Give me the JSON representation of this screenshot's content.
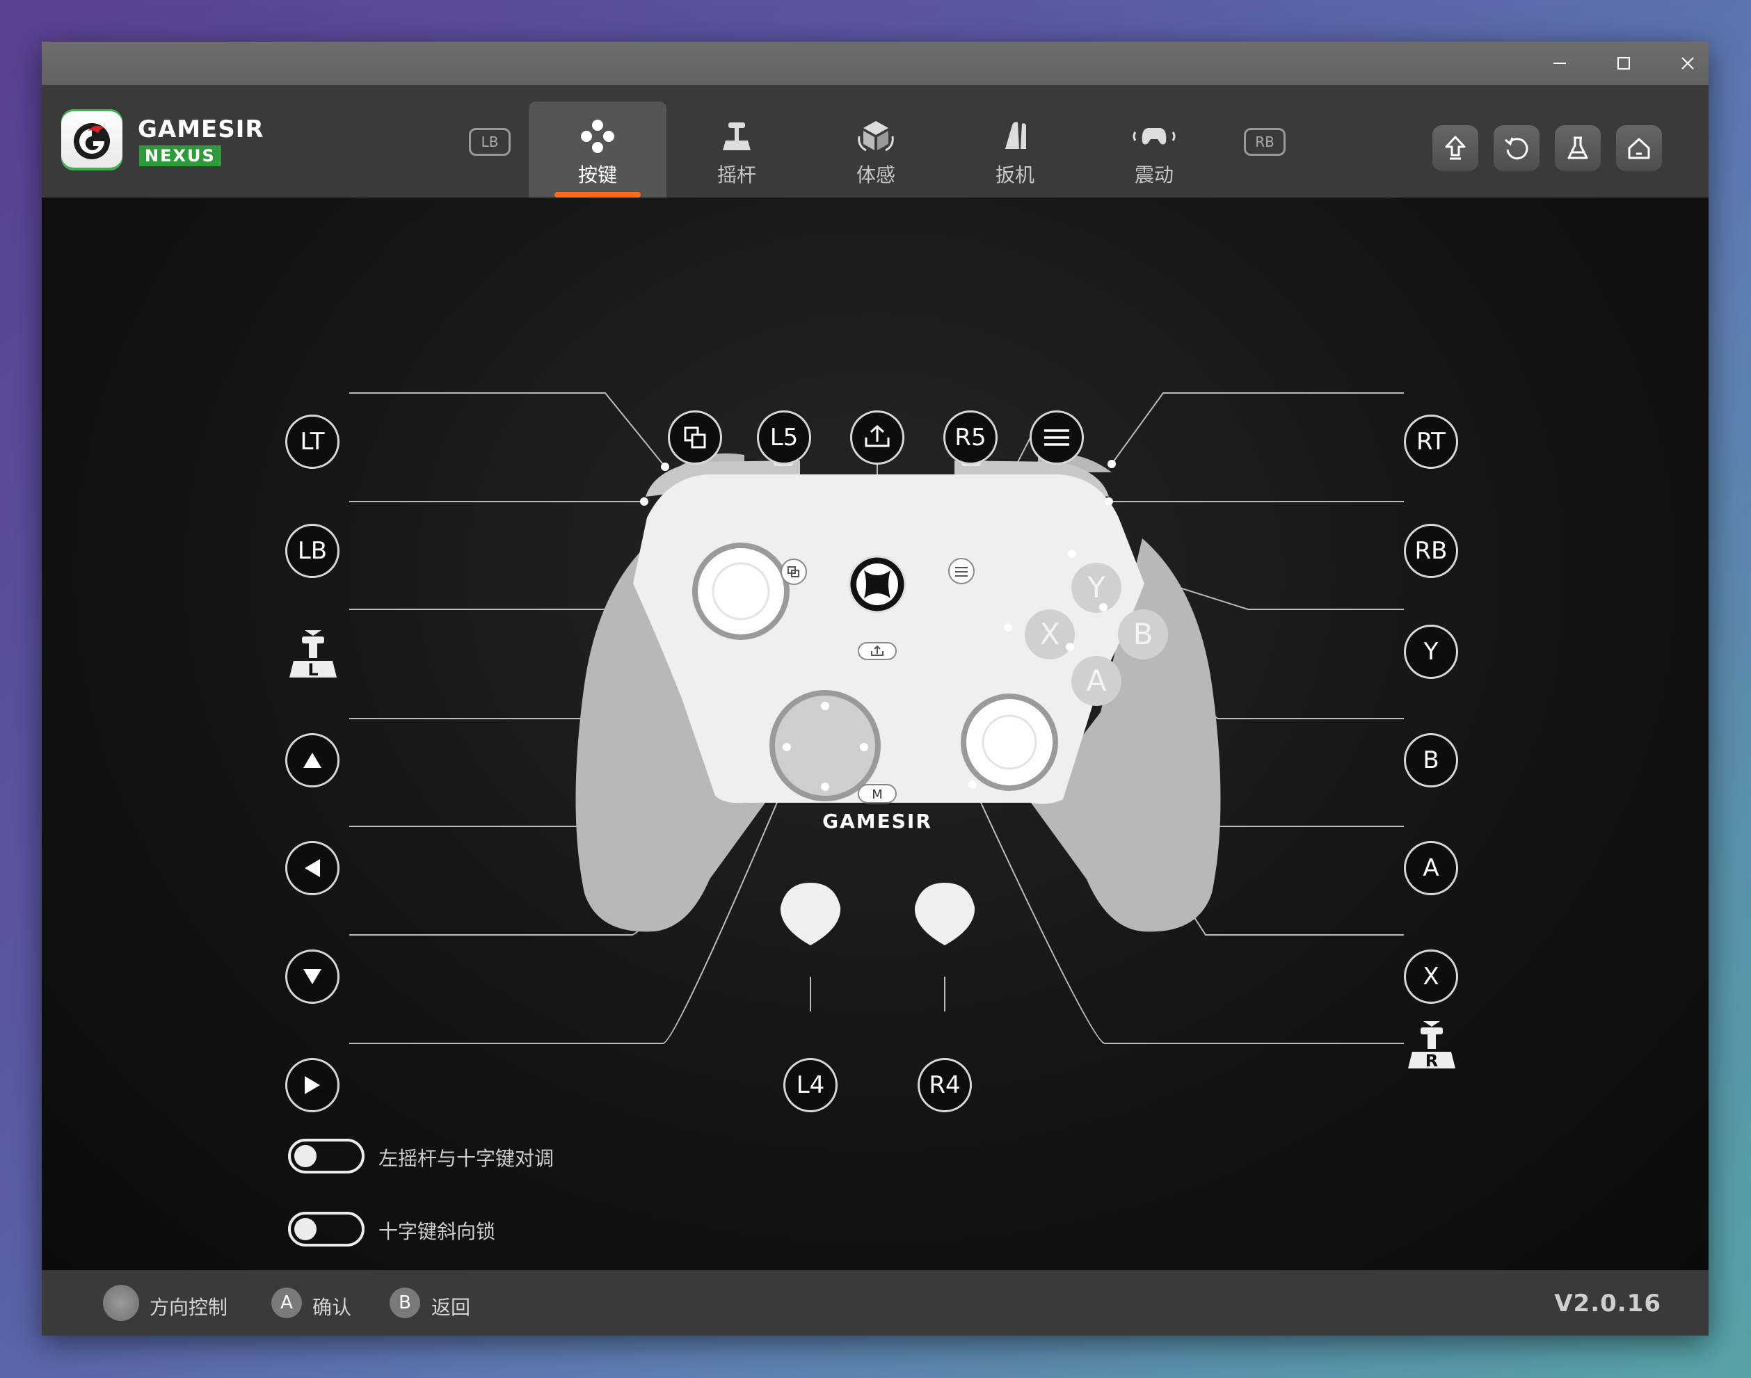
{
  "app": {
    "brand": "GAMESIR",
    "sub_brand": "NEXUS",
    "version": "V2.0.16"
  },
  "colors": {
    "accent": "#ff6a1a",
    "brand_green": "#2f9a3c",
    "controller_body": "#efefef",
    "controller_grip": "#b8b8b8"
  },
  "window_controls": [
    "minimize-icon",
    "maximize-icon",
    "close-icon"
  ],
  "nav": {
    "bumper_left": "LB",
    "bumper_right": "RB",
    "tabs": [
      {
        "label": "按键",
        "icon": "buttons-icon",
        "active": true
      },
      {
        "label": "摇杆",
        "icon": "joystick-icon",
        "active": false
      },
      {
        "label": "体感",
        "icon": "motion-cube-icon",
        "active": false
      },
      {
        "label": "扳机",
        "icon": "trigger-icon",
        "active": false
      },
      {
        "label": "震动",
        "icon": "vibration-icon",
        "active": false
      }
    ]
  },
  "header_actions": [
    "upgrade-icon",
    "reset-icon",
    "test-flask-icon",
    "home-icon"
  ],
  "mapping": {
    "left": [
      "LT",
      "LB",
      "L-stick",
      "dpad-up",
      "dpad-left",
      "dpad-down",
      "dpad-right"
    ],
    "top": [
      "view",
      "L5",
      "share",
      "R5",
      "menu"
    ],
    "right": [
      "RT",
      "RB",
      "Y",
      "B",
      "A",
      "X",
      "R-stick"
    ],
    "bottom": [
      "L4",
      "R4"
    ],
    "labels": {
      "LT": "LT",
      "LB": "LB",
      "L5": "L5",
      "R5": "R5",
      "RT": "RT",
      "RB": "RB",
      "Y": "Y",
      "B": "B",
      "A": "A",
      "X": "X",
      "L4": "L4",
      "R4": "R4",
      "stick_L": "L",
      "stick_R": "R"
    }
  },
  "controller": {
    "face_buttons": {
      "Y": "Y",
      "X": "X",
      "B": "B",
      "A": "A"
    },
    "m_button": "M",
    "logo_text": "GAMESIR"
  },
  "options": [
    {
      "label": "左摇杆与十字键对调",
      "enabled": false
    },
    {
      "label": "十字键斜向锁",
      "enabled": false
    }
  ],
  "footer": {
    "hints": [
      {
        "key": "",
        "label": "方向控制"
      },
      {
        "key": "A",
        "label": "确认"
      },
      {
        "key": "B",
        "label": "返回"
      }
    ]
  }
}
